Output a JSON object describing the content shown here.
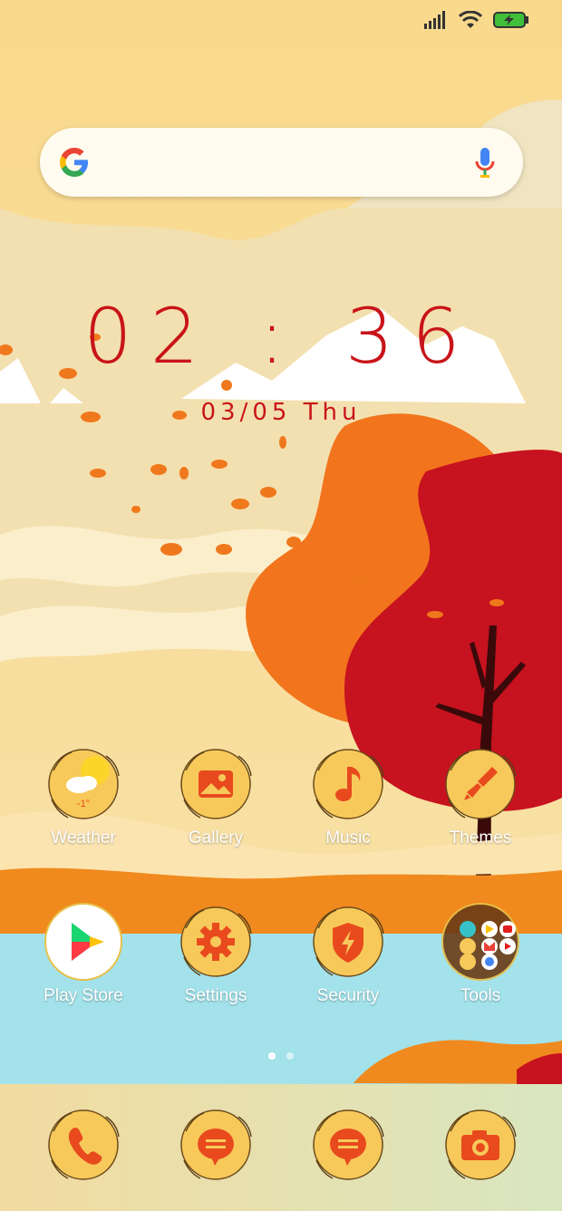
{
  "status_bar": {
    "icons": [
      "signal-icon",
      "wifi-icon",
      "battery-charging-icon"
    ]
  },
  "search_bar": {
    "logo": "google-logo-icon",
    "mic": "microphone-icon"
  },
  "clock": {
    "time": "02 : 36",
    "date": "03/05  Thu"
  },
  "apps_row1": [
    {
      "label": "Weather",
      "icon": "weather-icon",
      "temp": "-1°"
    },
    {
      "label": "Gallery",
      "icon": "gallery-icon"
    },
    {
      "label": "Music",
      "icon": "music-icon"
    },
    {
      "label": "Themes",
      "icon": "themes-brush-icon"
    }
  ],
  "apps_row2": [
    {
      "label": "Play Store",
      "icon": "play-store-icon"
    },
    {
      "label": "Settings",
      "icon": "settings-gear-icon"
    },
    {
      "label": "Security",
      "icon": "security-shield-icon"
    },
    {
      "label": "Tools",
      "icon": "tools-folder-icon"
    }
  ],
  "dock": [
    {
      "name": "phone",
      "icon": "phone-icon"
    },
    {
      "name": "messages",
      "icon": "message-icon"
    },
    {
      "name": "chat",
      "icon": "chat-icon"
    },
    {
      "name": "camera",
      "icon": "camera-icon"
    }
  ],
  "page_indicator": {
    "pages": 2,
    "active": 0
  },
  "colors": {
    "accent_red": "#c8141a",
    "icon_bg": "#f7c95a",
    "icon_glyph": "#e84a1e",
    "sky": "#f7dc9a",
    "water": "#a3e2ea"
  }
}
